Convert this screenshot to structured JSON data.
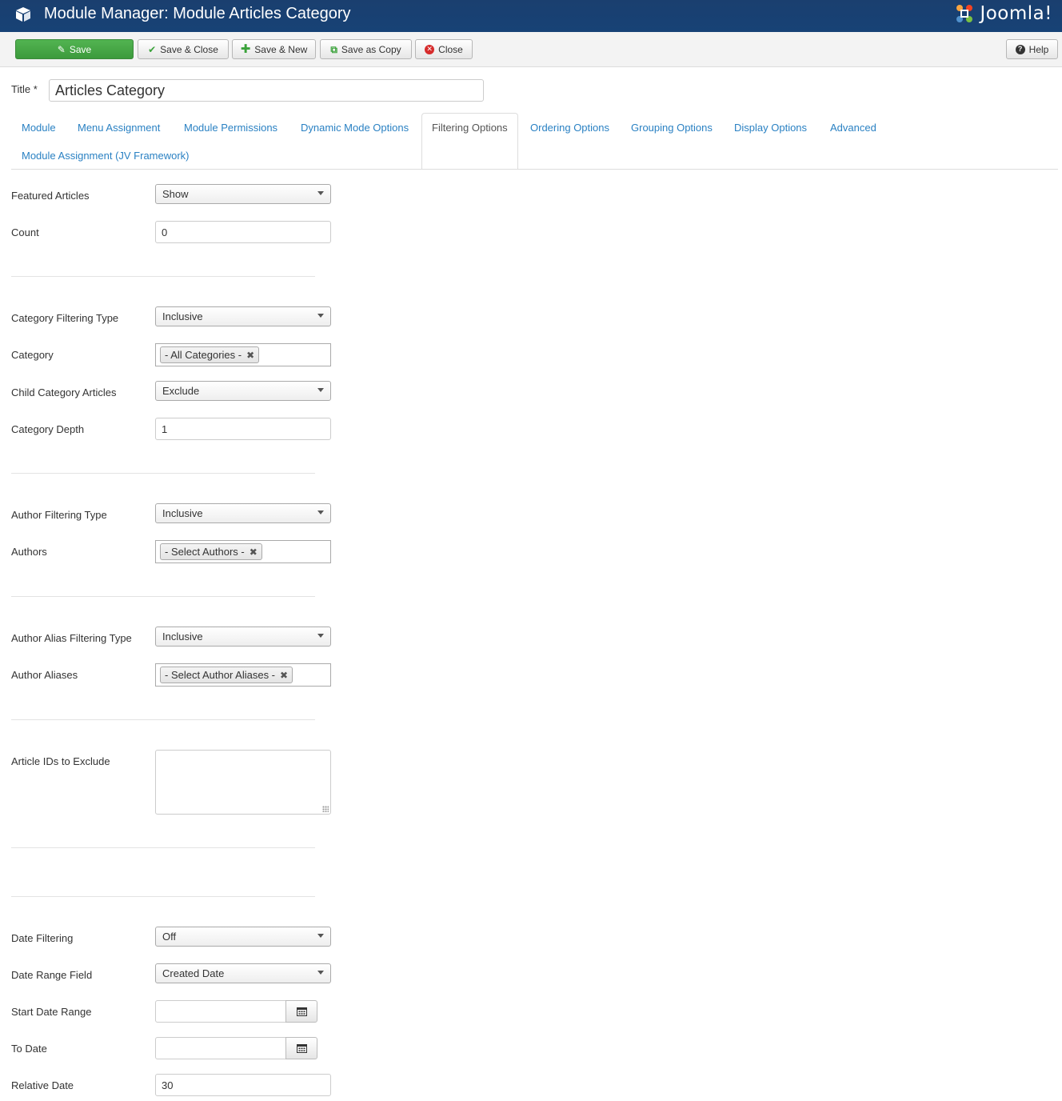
{
  "header": {
    "title": "Module Manager: Module Articles Category",
    "logo_text": "Joomla!"
  },
  "toolbar": {
    "save": "Save",
    "save_close": "Save & Close",
    "save_new": "Save & New",
    "save_copy": "Save as Copy",
    "close": "Close",
    "help": "Help"
  },
  "title_field": {
    "label": "Title *",
    "value": "Articles Category"
  },
  "tabs": [
    {
      "label": "Module",
      "active": false
    },
    {
      "label": "Menu Assignment",
      "active": false
    },
    {
      "label": "Module Permissions",
      "active": false
    },
    {
      "label": "Dynamic Mode Options",
      "active": false
    },
    {
      "label": "Filtering Options",
      "active": true
    },
    {
      "label": "Ordering Options",
      "active": false
    },
    {
      "label": "Grouping Options",
      "active": false
    },
    {
      "label": "Display Options",
      "active": false
    },
    {
      "label": "Advanced",
      "active": false
    },
    {
      "label": "Module Assignment (JV Framework)",
      "active": false
    }
  ],
  "fields": {
    "featured_articles": {
      "label": "Featured Articles",
      "value": "Show"
    },
    "count": {
      "label": "Count",
      "value": "0"
    },
    "category_filtering_type": {
      "label": "Category Filtering Type",
      "value": "Inclusive"
    },
    "category": {
      "label": "Category",
      "chip": "- All Categories -"
    },
    "child_category_articles": {
      "label": "Child Category Articles",
      "value": "Exclude"
    },
    "category_depth": {
      "label": "Category Depth",
      "value": "1"
    },
    "author_filtering_type": {
      "label": "Author Filtering Type",
      "value": "Inclusive"
    },
    "authors": {
      "label": "Authors",
      "chip": "- Select Authors -"
    },
    "author_alias_filtering_type": {
      "label": "Author Alias Filtering Type",
      "value": "Inclusive"
    },
    "author_aliases": {
      "label": "Author Aliases",
      "chip": "- Select Author Aliases -"
    },
    "article_ids_exclude": {
      "label": "Article IDs to Exclude",
      "value": ""
    },
    "date_filtering": {
      "label": "Date Filtering",
      "value": "Off"
    },
    "date_range_field": {
      "label": "Date Range Field",
      "value": "Created Date"
    },
    "start_date_range": {
      "label": "Start Date Range",
      "value": ""
    },
    "to_date": {
      "label": "To Date",
      "value": ""
    },
    "relative_date": {
      "label": "Relative Date",
      "value": "30"
    }
  },
  "colors": {
    "header_bg": "#174276",
    "save_green": "#46a546",
    "link_blue": "#2a81c3",
    "close_red": "#d62b2b"
  },
  "icons": {
    "header": "module-cube-icon",
    "save": "edit-icon",
    "save_close": "checkmark-icon",
    "save_new": "plus-icon",
    "save_copy": "copy-icon",
    "close": "close-circle-icon",
    "help": "question-circle-icon",
    "calendar": "calendar-icon"
  }
}
